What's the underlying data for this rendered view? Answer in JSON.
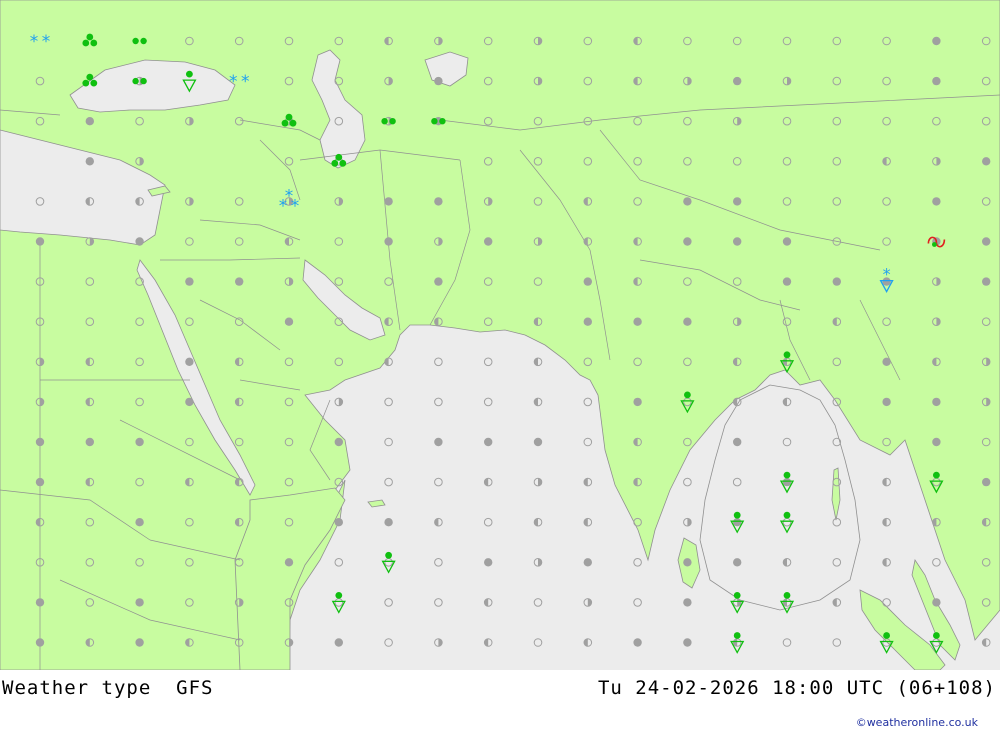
{
  "map": {
    "title": "Weather type",
    "model": "GFS",
    "valid_time": "Tu 24-02-2026 18:00 UTC (06+108)",
    "credit": "©weatheronline.co.uk",
    "colors": {
      "land": "#c8fca0",
      "sea": "#ececec",
      "border": "#909090",
      "dot": "#a0a0a0",
      "rain": "#10c010",
      "snow": "#20a0f0",
      "freezing": "#e02020"
    },
    "symbols": [
      {
        "type": "snow2",
        "col": 0,
        "row": 0
      },
      {
        "type": "rain3",
        "col": 1,
        "row": 0
      },
      {
        "type": "rain2",
        "col": 2,
        "row": 0
      },
      {
        "type": "rain3",
        "col": 1,
        "row": 1
      },
      {
        "type": "rain2",
        "col": 2,
        "row": 1
      },
      {
        "type": "shower",
        "col": 3,
        "row": 1
      },
      {
        "type": "snow2",
        "col": 4,
        "row": 1
      },
      {
        "type": "rain3",
        "col": 5,
        "row": 2
      },
      {
        "type": "rain2",
        "col": 7,
        "row": 2
      },
      {
        "type": "rain2",
        "col": 8,
        "row": 2
      },
      {
        "type": "rain3",
        "col": 6,
        "row": 3
      },
      {
        "type": "snow3",
        "col": 5,
        "row": 4
      },
      {
        "type": "freezing",
        "col": 18,
        "row": 5
      },
      {
        "type": "snowshower",
        "col": 17,
        "row": 6
      },
      {
        "type": "shower",
        "col": 15,
        "row": 8
      },
      {
        "type": "shower",
        "col": 13,
        "row": 9
      },
      {
        "type": "shower",
        "col": 15,
        "row": 11
      },
      {
        "type": "shower",
        "col": 18,
        "row": 11
      },
      {
        "type": "shower",
        "col": 14,
        "row": 12
      },
      {
        "type": "shower",
        "col": 15,
        "row": 12
      },
      {
        "type": "shower",
        "col": 7,
        "row": 13
      },
      {
        "type": "shower",
        "col": 6,
        "row": 14
      },
      {
        "type": "shower",
        "col": 14,
        "row": 14
      },
      {
        "type": "shower",
        "col": 15,
        "row": 14
      },
      {
        "type": "shower",
        "col": 14,
        "row": 15
      },
      {
        "type": "shower",
        "col": 17,
        "row": 15
      },
      {
        "type": "shower",
        "col": 18,
        "row": 15
      }
    ],
    "dot_grid": [
      "ss_.o..|:.:.|.....O.o",
      "._:__..:O.:.|:O:o.Oo",
      ".O.:.:.:O...oo:ooooo|",
      "_O:__o.__oo.o..o.|:O|",
      ".||:.::OO:o|.OOoo.O.",
      "O:O..|.O:O:||OOO..OO",
      "oooOO:..O..O|..OOO:O",
      "oooo.O.||.|OOO:o|.:.",
      ":|.O|..|..|.o.||oO|:",
      ":|.O|.:ooo|oO.||oOO:",
      "OOO..oOoOOO.|.O.o.O.",
      "O|.||.o..|:||..O.|.O",
      "|.O.|.OO|.||.:O..|||",
      "oooooOoooO:OoOO|o|o.",
      "O.O.:.o.o|.:oO:||oO.",
      "O|O|.:O.:|.|OO|.o..|"
    ]
  }
}
